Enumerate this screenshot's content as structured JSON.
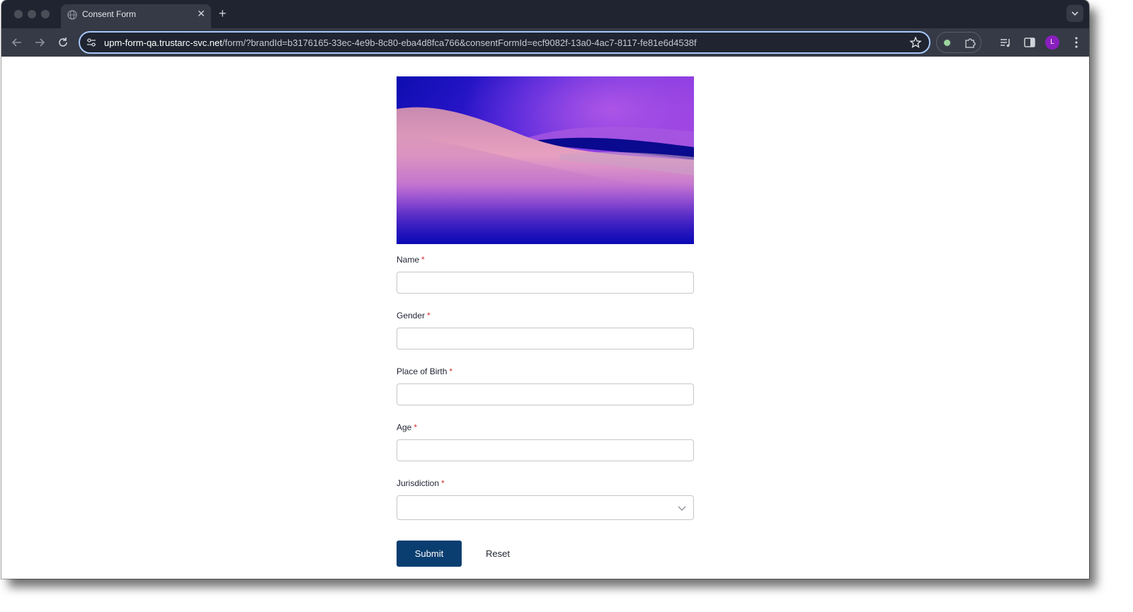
{
  "browser": {
    "tab": {
      "title": "Consent Form",
      "close_icon": "close-icon",
      "favicon": "globe-icon"
    },
    "new_tab_symbol": "+",
    "address_bar": {
      "host": "upm-form-qa.trustarc-svc.net",
      "path": "/form/?brandId=b3176165-33ec-4e9b-8c80-eba4d8fca766&consentFormId=ecf9082f-13a0-4ac7-8117-fe81e6d4538f"
    },
    "profile_initial": "L"
  },
  "form": {
    "hero_image": "purple-dunes-image",
    "fields": [
      {
        "label": "Name",
        "required_mark": "*",
        "value": ""
      },
      {
        "label": "Gender",
        "required_mark": "*",
        "value": ""
      },
      {
        "label": "Place of Birth",
        "required_mark": "*",
        "value": ""
      },
      {
        "label": "Age",
        "required_mark": "*",
        "value": ""
      }
    ],
    "jurisdiction": {
      "label": "Jurisdiction",
      "required_mark": "*",
      "selected": ""
    },
    "submit_label": "Submit",
    "reset_label": "Reset"
  },
  "colors": {
    "submit_button": "#0a3e70",
    "required_mark": "#d32f2f",
    "browser_frame": "#1f2430",
    "toolbar": "#353a46",
    "omnibox_focus": "#a8c7fa"
  }
}
